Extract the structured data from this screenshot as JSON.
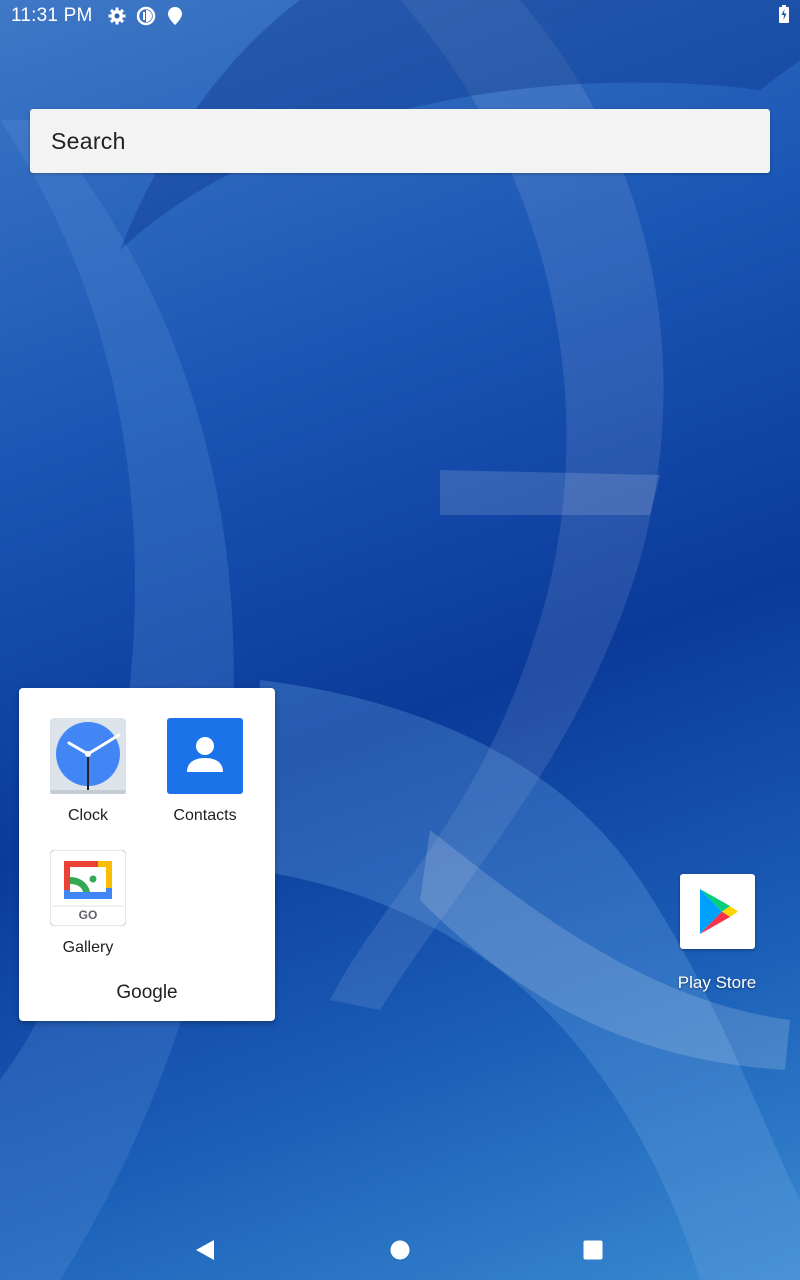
{
  "status_bar": {
    "time": "11:31 PM",
    "icons": [
      "gear-icon",
      "data-saver-icon",
      "location-icon",
      "battery-charging-icon"
    ]
  },
  "search": {
    "placeholder": "Search"
  },
  "folder": {
    "name": "Google",
    "apps": [
      {
        "label": "Clock",
        "icon": "clock-icon"
      },
      {
        "label": "Contacts",
        "icon": "contacts-icon"
      },
      {
        "label": "Gallery",
        "icon": "gallery-go-icon",
        "badge": "GO"
      }
    ]
  },
  "home_apps": [
    {
      "label": "Play Store",
      "icon": "play-store-icon"
    }
  ],
  "nav": {
    "buttons": [
      "back-icon",
      "home-icon",
      "recents-icon"
    ]
  },
  "colors": {
    "wallpaper_primary": "#1a56b5",
    "wallpaper_dark": "#0b3a9a",
    "search_bg": "#f3f3f3",
    "contacts_blue": "#1a73e8",
    "clock_blue": "#4285f4"
  }
}
